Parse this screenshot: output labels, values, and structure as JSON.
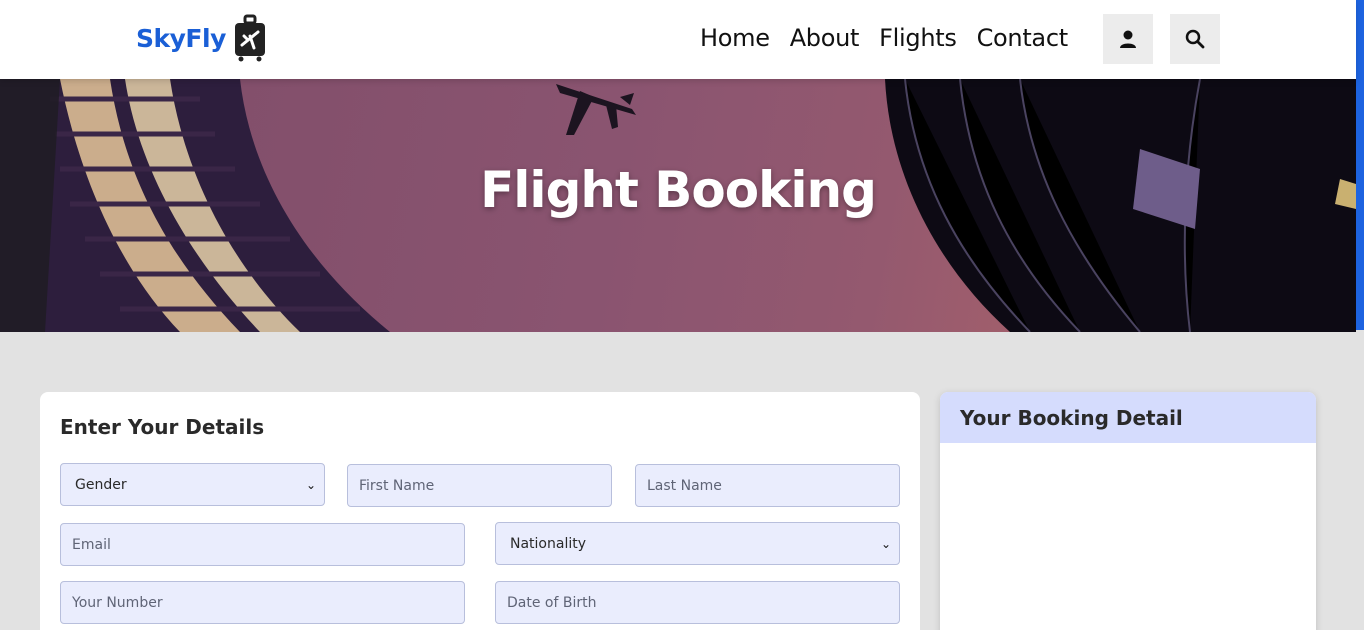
{
  "brand": {
    "name": "SkyFly",
    "logo_icon": "luggage-plane-icon",
    "color": "#1a5fd6"
  },
  "nav": {
    "links": [
      "Home",
      "About",
      "Flights",
      "Contact"
    ],
    "user_icon": "user-icon",
    "search_icon": "search-icon"
  },
  "hero": {
    "title": "Flight Booking"
  },
  "details": {
    "title": "Enter Your Details",
    "gender_select": "Gender",
    "first_name_placeholder": "First Name",
    "last_name_placeholder": "Last Name",
    "email_placeholder": "Email",
    "nationality_select": "Nationality",
    "number_placeholder": "Your Number",
    "dob_placeholder": "Date of Birth"
  },
  "booking": {
    "title": "Your Booking Detail"
  },
  "colors": {
    "field_bg": "#eaedfd",
    "booking_header_bg": "#d5dcfd",
    "accent": "#1d63e0"
  }
}
